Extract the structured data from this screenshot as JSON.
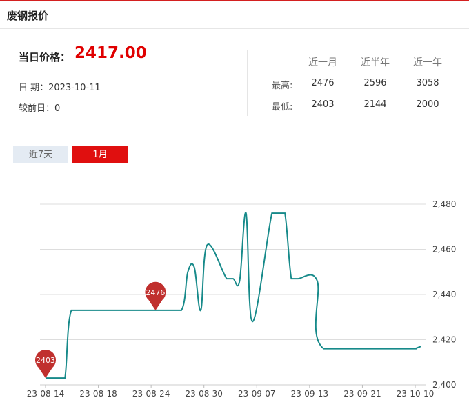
{
  "header": {
    "title": "废钢报价"
  },
  "summary": {
    "price_label": "当日价格：",
    "price_value": "2417.00",
    "date_text": "日 期：2023-10-11",
    "change_text": "较前日：0"
  },
  "stats": {
    "columns": [
      "近一月",
      "近半年",
      "近一年"
    ],
    "rows": [
      {
        "label": "最高:",
        "values": [
          "2476",
          "2596",
          "3058"
        ]
      },
      {
        "label": "最低:",
        "values": [
          "2403",
          "2144",
          "2000"
        ]
      }
    ]
  },
  "tabs": [
    {
      "label": "近7天",
      "active": false
    },
    {
      "label": "1月",
      "active": true
    }
  ],
  "colors": {
    "accent": "#e00f0f",
    "line": "#178a8a",
    "marker": "#c0302e"
  },
  "chart_data": {
    "type": "line",
    "title": "",
    "xlabel": "",
    "ylabel": "",
    "x_ticks": [
      "23-08-14",
      "23-08-18",
      "23-08-24",
      "23-08-30",
      "23-09-07",
      "23-09-13",
      "23-09-21",
      "23-10-10"
    ],
    "y_ticks": [
      "2,400",
      "2,420",
      "2,440",
      "2,460",
      "2,480"
    ],
    "ylim": [
      2400,
      2480
    ],
    "grid": true,
    "series": [
      {
        "x": [
          "2023-08-14",
          "2023-08-15",
          "2023-08-16",
          "2023-08-17",
          "2023-08-18",
          "2023-08-21",
          "2023-08-22",
          "2023-08-23",
          "2023-08-24",
          "2023-08-25",
          "2023-08-28",
          "2023-08-29",
          "2023-08-30",
          "2023-08-31",
          "2023-09-01",
          "2023-09-04",
          "2023-09-05",
          "2023-09-06",
          "2023-09-07",
          "2023-09-08",
          "2023-09-11",
          "2023-09-12",
          "2023-09-13",
          "2023-09-14",
          "2023-09-15",
          "2023-09-18",
          "2023-09-19",
          "2023-09-20",
          "2023-09-21",
          "2023-09-22",
          "2023-09-25",
          "2023-09-26",
          "2023-10-09",
          "2023-10-10",
          "2023-10-11"
        ],
        "values": [
          2403,
          2403,
          2403,
          2403,
          2433,
          2433,
          2433,
          2433,
          2433,
          2433,
          2433,
          2433,
          2433,
          2433,
          2433,
          2433,
          2450,
          2452,
          2433,
          2462,
          2447,
          2447,
          2446,
          2476,
          2428,
          2476,
          2476,
          2476,
          2447,
          2447,
          2446,
          2416,
          2416,
          2416,
          2417
        ]
      }
    ],
    "markers": [
      {
        "label": "2476",
        "index": 13
      },
      {
        "label": "2403",
        "index": 0
      }
    ]
  }
}
